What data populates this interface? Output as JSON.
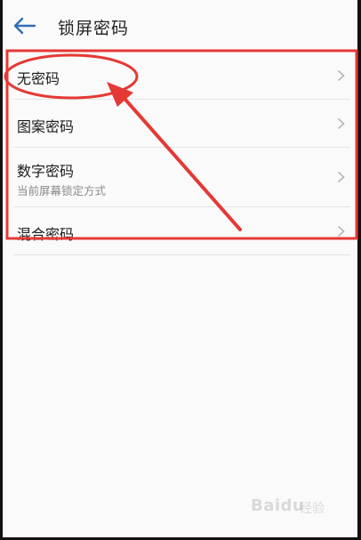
{
  "header": {
    "title": "锁屏密码",
    "back_icon": "back-arrow-icon"
  },
  "options": [
    {
      "label": "无密码",
      "sublabel": ""
    },
    {
      "label": "图案密码",
      "sublabel": ""
    },
    {
      "label": "数字密码",
      "sublabel": "当前屏幕锁定方式"
    },
    {
      "label": "混合密码",
      "sublabel": ""
    }
  ],
  "annotation": {
    "color": "#e53935",
    "shapes": [
      "highlight-box",
      "circle",
      "arrow"
    ]
  },
  "watermark": {
    "brand": "Baidu",
    "suffix": "经验"
  },
  "colors": {
    "accent": "#2f6fb5",
    "text": "#1c1c1c",
    "subtext": "#8a8a8a",
    "annotation": "#e53935"
  }
}
